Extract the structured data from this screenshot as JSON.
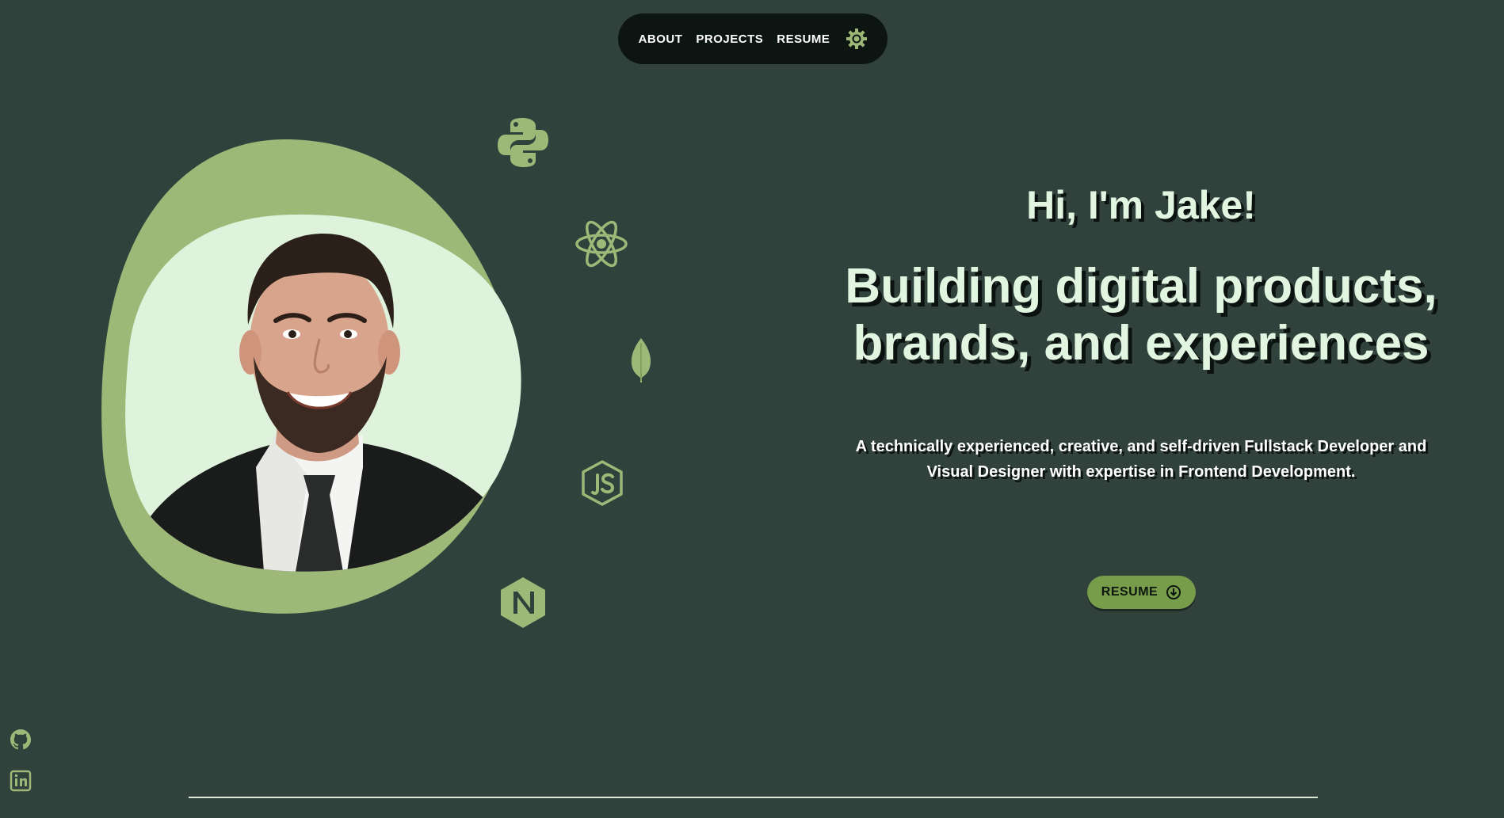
{
  "nav": {
    "items": [
      {
        "label": "ABOUT"
      },
      {
        "label": "PROJECTS"
      },
      {
        "label": "RESUME"
      }
    ],
    "theme_toggle_icon": "sun-icon"
  },
  "hero": {
    "greeting": "Hi, I'm Jake!",
    "headline_line1": "Building digital products,",
    "headline_line2": "brands, and experiences",
    "intro_line1": "A technically experienced, creative, and self-driven Fullstack Developer and",
    "intro_line2": "Visual Designer with expertise in Frontend Development.",
    "resume_button_label": "RESUME",
    "resume_button_icon": "download-circle-icon"
  },
  "portrait": {
    "icon": "portrait-photo"
  },
  "tech_icons": [
    "python-icon",
    "react-icon",
    "mongodb-leaf-icon",
    "nodejs-icon",
    "nginx-icon"
  ],
  "socials": [
    "github-icon",
    "linkedin-icon"
  ],
  "colors": {
    "background": "#31413c",
    "accent": "#9eb878",
    "accent_dark": "#779c4a",
    "text_light": "#e2f5e1",
    "nav_bg": "#0c1512"
  }
}
